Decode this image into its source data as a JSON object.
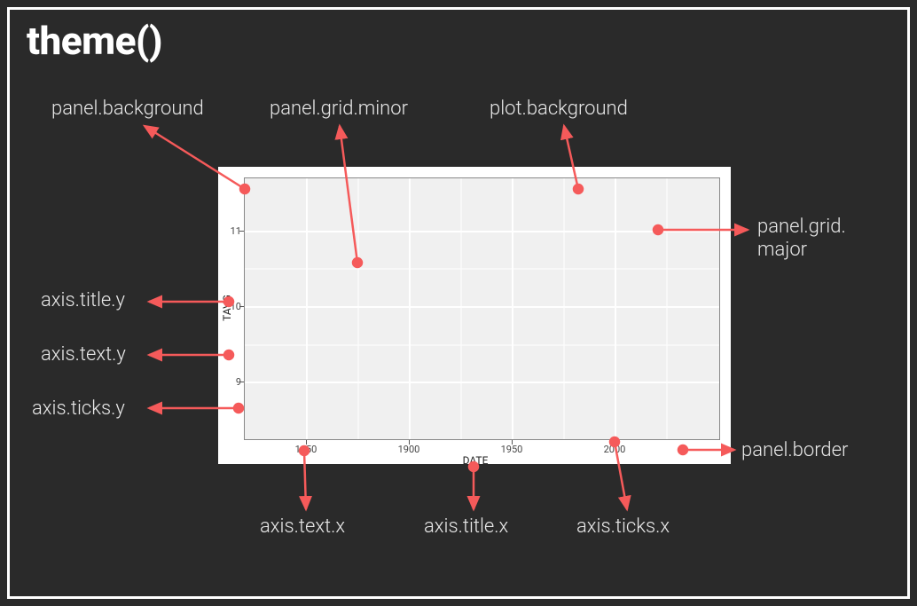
{
  "title": "theme()",
  "chart_data": {
    "type": "scatter",
    "title": "",
    "xlabel": "DATE",
    "ylabel": "TAVG",
    "xlim": [
      1820,
      2050
    ],
    "ylim": [
      8.5,
      11.5
    ],
    "x_ticks": [
      1850,
      1900,
      1950,
      2000
    ],
    "y_ticks": [
      9,
      10,
      11
    ],
    "x_minor": [
      1875,
      1925,
      1975,
      2025
    ],
    "y_minor": [
      9.5,
      10.5
    ],
    "series": []
  },
  "labels": {
    "panel_background": "panel.background",
    "panel_grid_minor": "panel.grid.minor",
    "plot_background": "plot.background",
    "panel_grid_major": "panel.grid.",
    "panel_grid_major2": "major",
    "axis_title_y": "axis.title.y",
    "axis_text_y": "axis.text.y",
    "axis_ticks_y": "axis.ticks.y",
    "axis_text_x": "axis.text.x",
    "axis_title_x": "axis.title.x",
    "axis_ticks_x": "axis.ticks.x",
    "panel_border": "panel.border"
  },
  "colors": {
    "accent": "#f55a5a",
    "panel_bg": "#f0f0f0",
    "grid_major": "#ffffff",
    "grid_minor": "#ffffff"
  }
}
